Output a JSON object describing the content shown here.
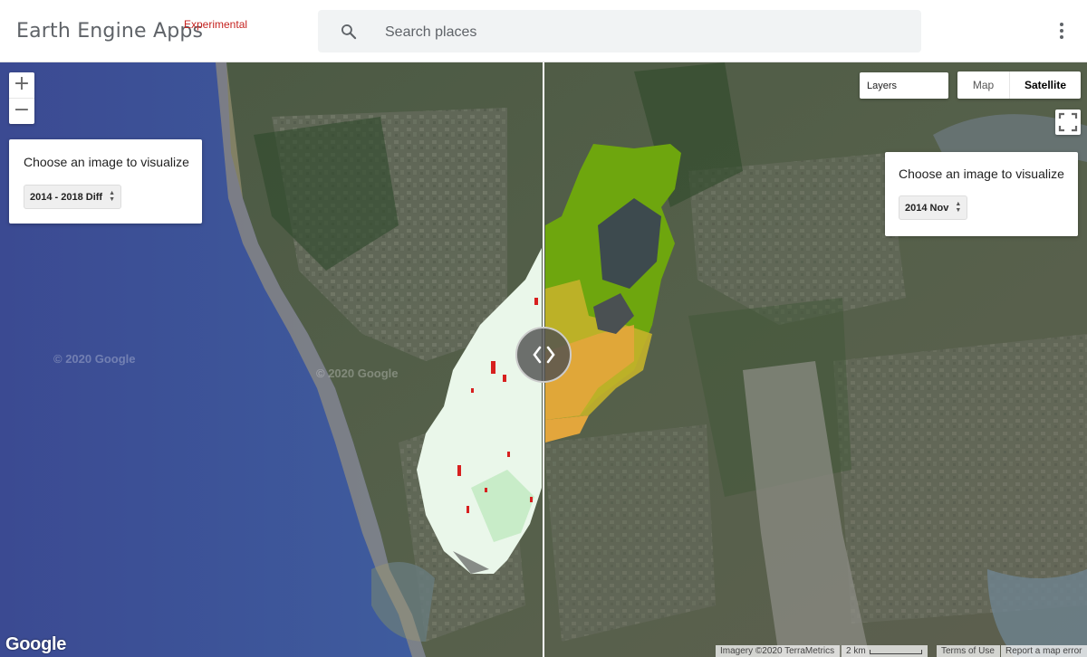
{
  "header": {
    "title": "Earth Engine Apps",
    "badge": "Experimental",
    "search_placeholder": "Search places",
    "search_icon": "search-icon",
    "menu_icon": "more-vert-icon"
  },
  "map": {
    "zoom_in_label": "+",
    "zoom_out_label": "−",
    "layers_label": "Layers",
    "map_type": {
      "map_label": "Map",
      "satellite_label": "Satellite",
      "selected": "Satellite"
    },
    "fullscreen_icon": "fullscreen-icon",
    "swipe_icon": "swipe-chevrons-icon",
    "watermark": "© 2020 Google",
    "logo": "Google",
    "footer": {
      "imagery": "Imagery ©2020 TerraMetrics",
      "scale": "2 km",
      "terms": "Terms of Use",
      "report": "Report a map error"
    }
  },
  "left_panel": {
    "title": "Choose an image to visualize",
    "selected": "2014 - 2018 Diff"
  },
  "right_panel": {
    "title": "Choose an image to visualize",
    "selected": "2014 Nov"
  },
  "colors": {
    "badge": "#c5221f",
    "sea": "#3e4e94",
    "land": "#4b5540"
  }
}
